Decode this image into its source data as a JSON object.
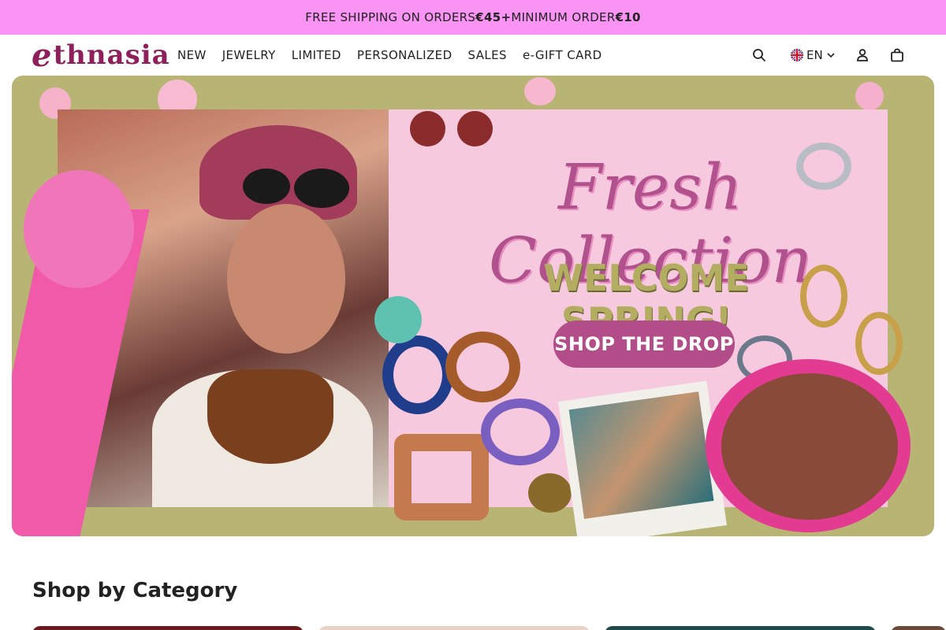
{
  "announcement": {
    "prefix": "FREE SHIPPING ON ORDERS ",
    "threshold": "€45+",
    "middle": " MINIMUM ORDER ",
    "minimum": "€10"
  },
  "brand": {
    "initial": "e",
    "rest": "thnasia",
    "color": "#8e1f5b"
  },
  "nav": {
    "items": [
      {
        "label": "NEW"
      },
      {
        "label": "JEWELRY"
      },
      {
        "label": "LIMITED"
      },
      {
        "label": "PERSONALIZED"
      },
      {
        "label": "SALES"
      },
      {
        "label": "e-GIFT CARD"
      }
    ]
  },
  "header_tools": {
    "search_icon": "search-icon",
    "language": "EN",
    "account_icon": "user-icon",
    "cart_icon": "shopping-bag-icon"
  },
  "hero": {
    "title": "Fresh Collection",
    "subtitle": "WELCOME SPRING!",
    "cta": "SHOP THE DROP",
    "colors": {
      "frame": "#b8b474",
      "panel": "#f7c9df",
      "title": "#b1528f",
      "cta": "#b24d89"
    }
  },
  "categories": {
    "heading": "Shop by Category"
  },
  "colors": {
    "announcement_bg": "#f993f4",
    "text": "#222222"
  }
}
